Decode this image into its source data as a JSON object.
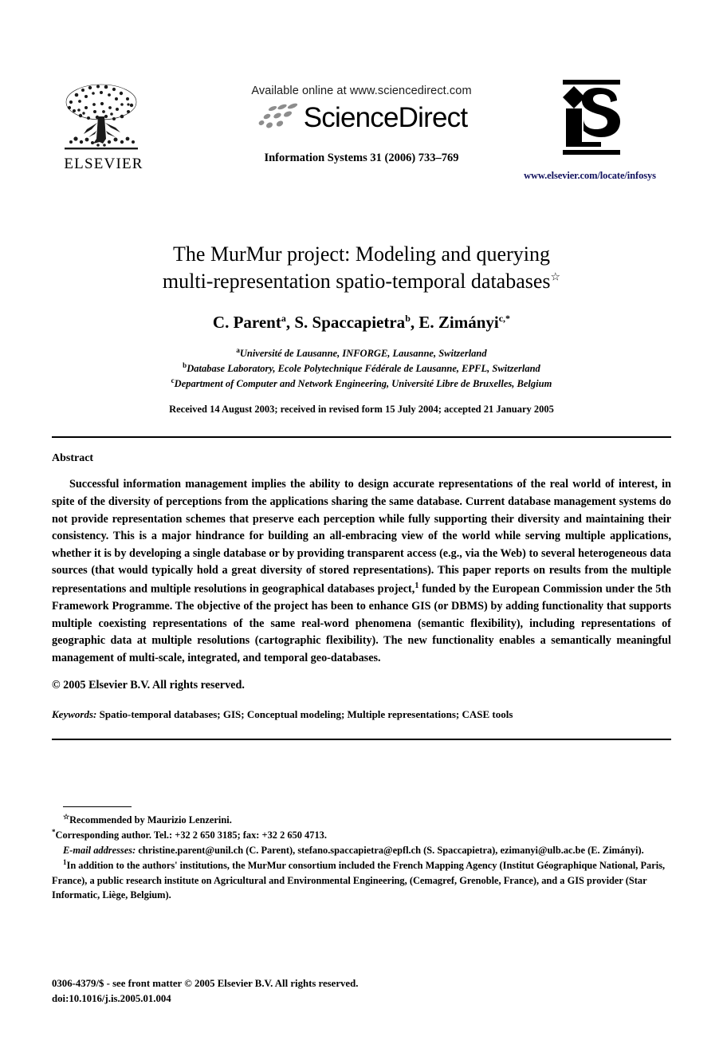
{
  "masthead": {
    "publisher_name": "ELSEVIER",
    "available_line": "Available online at www.sciencedirect.com",
    "sciencedirect_wordmark": "ScienceDirect",
    "journal_reference": "Information Systems 31 (2006) 733–769",
    "journal_logo_text": "iS",
    "journal_url": "www.elsevier.com/locate/infosys",
    "url_color": "#12125e"
  },
  "title": {
    "line1": "The MurMur project: Modeling and querying",
    "line2": "multi-representation spatio-temporal databases",
    "footnote_marker": "☆"
  },
  "authors": {
    "list": [
      {
        "name": "C. Parent",
        "marker": "a"
      },
      {
        "name": "S. Spaccapietra",
        "marker": "b"
      },
      {
        "name": "E. Zimányi",
        "marker": "c,*"
      }
    ]
  },
  "affiliations": [
    {
      "marker": "a",
      "text": "Université de Lausanne, INFORGE, Lausanne, Switzerland"
    },
    {
      "marker": "b",
      "text": "Database Laboratory, Ecole Polytechnique Fédérale de Lausanne, EPFL, Switzerland"
    },
    {
      "marker": "c",
      "text": "Department of Computer and Network Engineering, Université Libre de Bruxelles, Belgium"
    }
  ],
  "history": "Received 14 August 2003; received in revised form 15 July 2004; accepted 21 January 2005",
  "abstract": {
    "heading": "Abstract",
    "body_part1": "Successful information management implies the ability to design accurate representations of the real world of interest, in spite of the diversity of perceptions from the applications sharing the same database. Current database management systems do not provide representation schemes that preserve each perception while fully supporting their diversity and maintaining their consistency. This is a major hindrance for building an all-embracing view of the world while serving multiple applications, whether it is by developing a single database or by providing transparent access (e.g., via the Web) to several heterogeneous data sources (that would typically hold a great diversity of stored representations). This paper reports on results from the multiple representations and multiple resolutions in geographical databases project,",
    "footnote_ref": "1",
    "body_part2": " funded by the European Commission under the 5th Framework Programme. The objective of the project has been to enhance GIS (or DBMS) by adding functionality that supports multiple coexisting representations of the same real-word phenomena (semantic flexibility), including representations of geographic data at multiple resolutions (cartographic flexibility). The new functionality enables a semantically meaningful management of multi-scale, integrated, and temporal geo-databases.",
    "copyright": "© 2005 Elsevier B.V. All rights reserved."
  },
  "keywords": {
    "label": "Keywords:",
    "text": "Spatio-temporal databases; GIS; Conceptual modeling; Multiple representations; CASE tools"
  },
  "footnotes": {
    "recommended": {
      "marker": "☆",
      "text": "Recommended by Maurizio Lenzerini."
    },
    "corresponding": {
      "marker": "*",
      "text": "Corresponding author. Tel.: +32 2 650 3185; fax: +32 2 650 4713."
    },
    "emails": {
      "label": "E-mail addresses:",
      "text": "christine.parent@unil.ch (C. Parent), stefano.spaccapietra@epfl.ch (S. Spaccapietra), ezimanyi@ulb.ac.be (E. Zimányi)."
    },
    "consortium": {
      "marker": "1",
      "text": "In addition to the authors' institutions, the MurMur consortium included the French Mapping Agency (Institut Géographique National, Paris, France), a public research institute on Agricultural and Environmental Engineering, (Cemagref, Grenoble, France), and a GIS provider (Star Informatic, Liège, Belgium)."
    }
  },
  "imprint": {
    "front_matter": "0306-4379/$ - see front matter © 2005 Elsevier B.V. All rights reserved.",
    "doi": "doi:10.1016/j.is.2005.01.004"
  }
}
